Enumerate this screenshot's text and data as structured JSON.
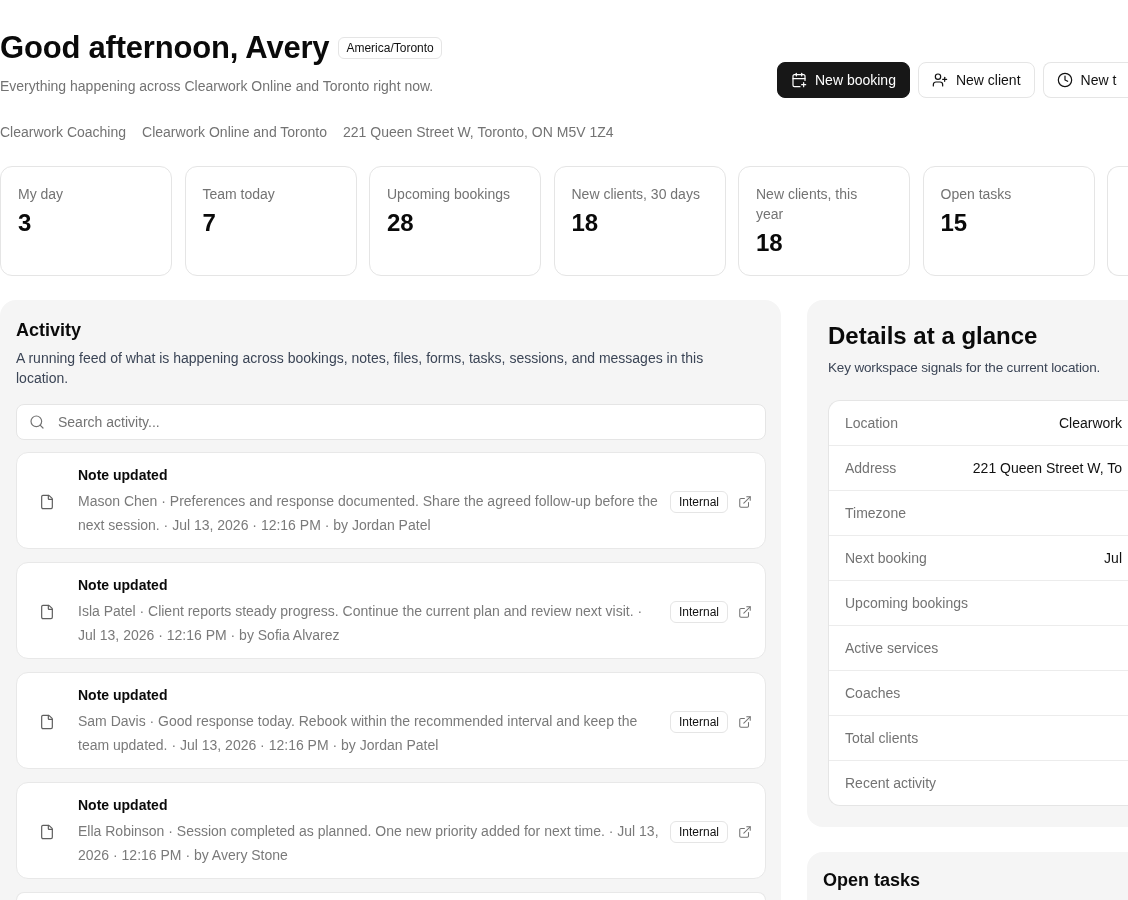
{
  "header": {
    "greeting": "Good afternoon, Avery",
    "timezone_badge": "America/Toronto",
    "subtitle": "Everything happening across Clearwork Online and Toronto right now.",
    "actions": [
      {
        "kind": "booking",
        "primary": true,
        "label": "New booking"
      },
      {
        "kind": "client",
        "primary": false,
        "label": "New client"
      },
      {
        "kind": "task",
        "primary": false,
        "label": "New t"
      }
    ]
  },
  "meta": [
    "Clearwork Coaching",
    "Clearwork Online and Toronto",
    "221 Queen Street W, Toronto, ON M5V 1Z4"
  ],
  "stats": [
    {
      "label": "My day",
      "value": "3"
    },
    {
      "label": "Team today",
      "value": "7"
    },
    {
      "label": "Upcoming bookings",
      "value": "28"
    },
    {
      "label": "New clients, 30 days",
      "value": "18"
    },
    {
      "label": "New clients, this year",
      "value": "18"
    },
    {
      "label": "Open tasks",
      "value": "15"
    }
  ],
  "activity": {
    "title": "Activity",
    "description": "A running feed of what is happening across bookings, notes, files, forms, tasks, sessions, and messages in this location.",
    "search": {
      "placeholder": "Search activity..."
    },
    "items": [
      {
        "title": "Note updated",
        "body": "Mason Chen · Preferences and response documented. Share the agreed follow-up before the next session. · Jul 13, 2026 · 12:16 PM · by Jordan Patel",
        "badge": "Internal"
      },
      {
        "title": "Note updated",
        "body": "Isla Patel · Client reports steady progress. Continue the current plan and review next visit. · Jul 13, 2026 · 12:16 PM · by Sofia Alvarez",
        "badge": "Internal"
      },
      {
        "title": "Note updated",
        "body": "Sam Davis · Good response today. Rebook within the recommended interval and keep the team updated. · Jul 13, 2026 · 12:16 PM · by Jordan Patel",
        "badge": "Internal"
      },
      {
        "title": "Note updated",
        "body": "Ella Robinson · Session completed as planned. One new priority added for next time. · Jul 13, 2026 · 12:16 PM · by Avery Stone",
        "badge": "Internal"
      }
    ]
  },
  "details": {
    "title": "Details at a glance",
    "description": "Key workspace signals for the current location.",
    "rows": [
      {
        "label": "Location",
        "value": "Clearwork"
      },
      {
        "label": "Address",
        "value": "221 Queen Street W, To"
      },
      {
        "label": "Timezone"
      },
      {
        "label": "Next booking",
        "value": "Jul"
      },
      {
        "label": "Upcoming bookings"
      },
      {
        "label": "Active services"
      },
      {
        "label": "Coaches"
      },
      {
        "label": "Total clients"
      },
      {
        "label": "Recent activity"
      }
    ]
  },
  "open_tasks": {
    "title": "Open tasks"
  }
}
